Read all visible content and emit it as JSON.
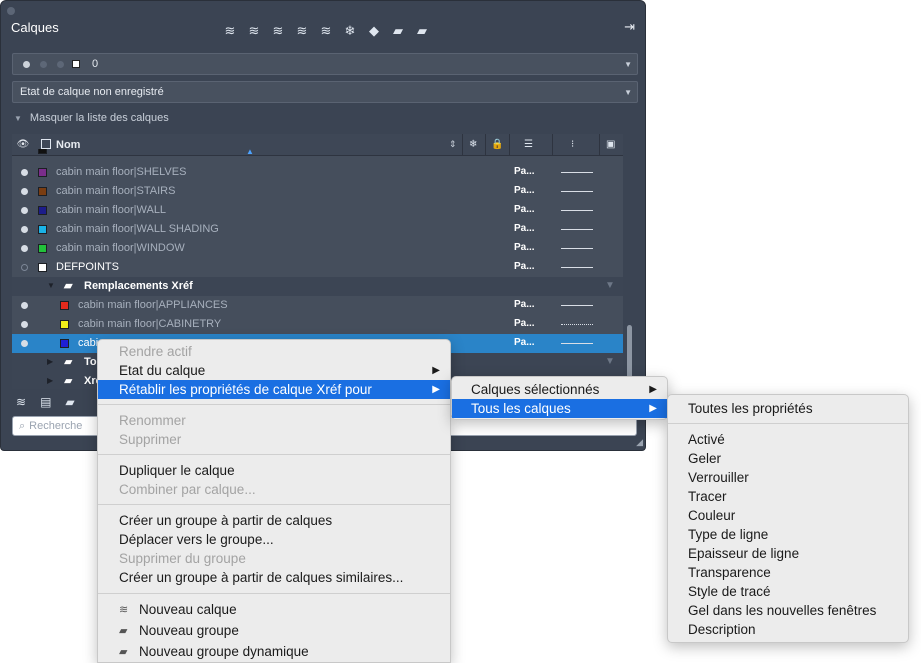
{
  "palette": {
    "title": "Calques",
    "toolbar_icons": [
      "new-layer-icon",
      "new-layer-vp-frozen-icon",
      "delete-layer-icon",
      "set-current-icon",
      "layer-states-icon",
      "freeze-icon",
      "off-icon",
      "lock-icon",
      "unlock-icon"
    ],
    "current_layer": "0",
    "layer_state": "Etat de calque non enregistré",
    "hide_list": "Masquer la liste des calques",
    "header": {
      "name": "Nom"
    },
    "rows": [
      {
        "name": "cabin main floor|SHELVES",
        "color": "#7b2d8b",
        "pa": "Pa...",
        "white": false
      },
      {
        "name": "cabin main floor|STAIRS",
        "color": "#7a3d12",
        "pa": "Pa...",
        "white": false
      },
      {
        "name": "cabin main floor|WALL",
        "color": "#1d1d8a",
        "pa": "Pa...",
        "white": false
      },
      {
        "name": "cabin main floor|WALL SHADING",
        "color": "#1ab2e6",
        "pa": "Pa...",
        "white": false
      },
      {
        "name": "cabin main floor|WINDOW",
        "color": "#22c23a",
        "pa": "Pa...",
        "white": false
      },
      {
        "name": "DEFPOINTS",
        "color": "#ffffff",
        "pa": "Pa...",
        "white": true
      }
    ],
    "group_xref": "Remplacements Xréf",
    "xref_rows": [
      {
        "name": "cabin main floor|APPLIANCES",
        "color": "#e32a1c",
        "pa": "Pa..."
      },
      {
        "name": "cabin main floor|CABINETRY",
        "color": "#f2ef1a",
        "pa": "Pa..."
      },
      {
        "name": "cabi",
        "color": "#1f1fd6",
        "pa": "Pa..."
      }
    ],
    "collapsed_groups": [
      "To",
      "Xre"
    ],
    "search_placeholder": "Recherche"
  },
  "context_menu": {
    "items": [
      {
        "label": "Rendre actif",
        "disabled": true
      },
      {
        "label": "Etat du calque",
        "disabled": false,
        "submenu": true
      },
      {
        "label": "Rétablir les propriétés de calque Xréf pour",
        "disabled": false,
        "submenu": true,
        "highlight": true
      },
      {
        "label": "Renommer",
        "disabled": true
      },
      {
        "label": "Supprimer",
        "disabled": true
      },
      {
        "label": "Dupliquer le calque",
        "disabled": false
      },
      {
        "label": "Combiner par calque...",
        "disabled": true
      },
      {
        "label": "Créer un groupe à partir de calques",
        "disabled": false
      },
      {
        "label": "Déplacer vers le groupe...",
        "disabled": false
      },
      {
        "label": "Supprimer du groupe",
        "disabled": true
      },
      {
        "label": "Créer un groupe à partir de calques similaires...",
        "disabled": false
      },
      {
        "label": "Nouveau calque",
        "disabled": false
      },
      {
        "label": "Nouveau groupe",
        "disabled": false
      },
      {
        "label": "Nouveau groupe dynamique",
        "disabled": false
      }
    ]
  },
  "submenu1": {
    "items": [
      {
        "label": "Calques sélectionnés",
        "highlight": false
      },
      {
        "label": "Tous les calques",
        "highlight": true
      }
    ]
  },
  "submenu2": {
    "items": [
      "Toutes les propriétés",
      "Activé",
      "Geler",
      "Verrouiller",
      "Tracer",
      "Couleur",
      "Type de ligne",
      "Epaisseur de ligne",
      "Transparence",
      "Style de tracé",
      "Gel dans les nouvelles fenêtres",
      "Description"
    ]
  }
}
